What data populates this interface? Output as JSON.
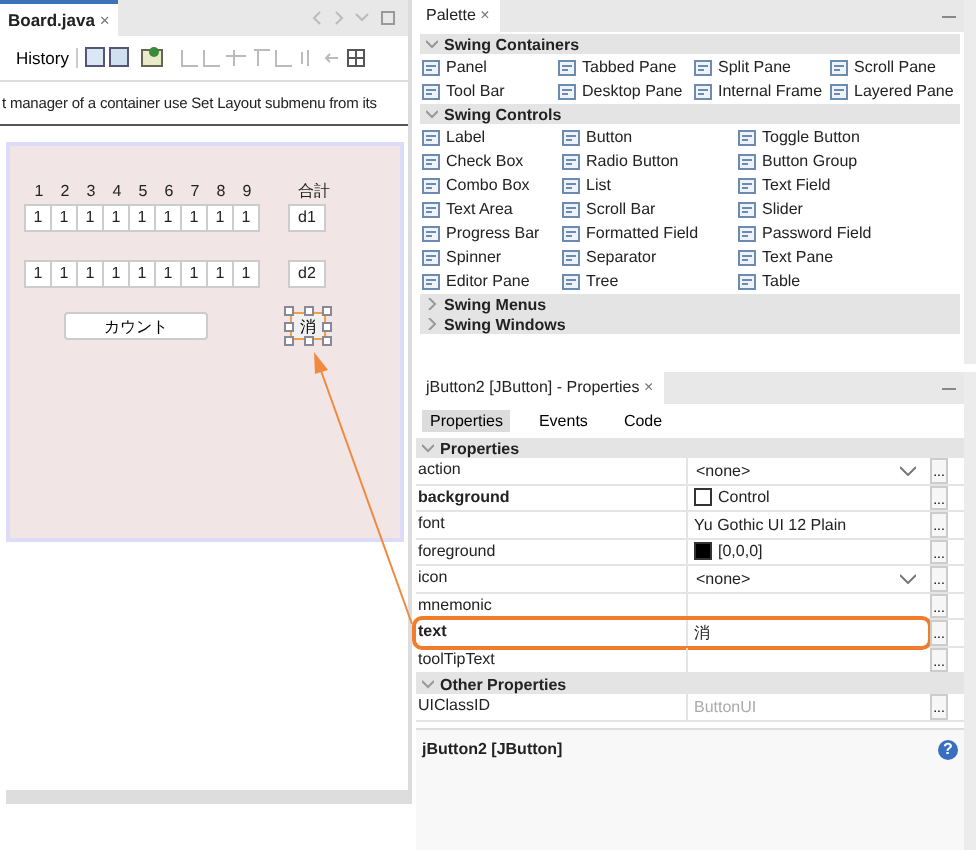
{
  "editor": {
    "tab_title": "Board.java",
    "close": "×",
    "toolbar_label": "History",
    "info_text": "t manager of a container use Set Layout submenu from its",
    "form": {
      "header_labels": [
        "1",
        "2",
        "3",
        "4",
        "5",
        "6",
        "7",
        "8",
        "9"
      ],
      "total_label": "合計",
      "rows": [
        {
          "cells": [
            "1",
            "1",
            "1",
            "1",
            "1",
            "1",
            "1",
            "1",
            "1"
          ],
          "result": "d1"
        },
        {
          "cells": [
            "1",
            "1",
            "1",
            "1",
            "1",
            "1",
            "1",
            "1",
            "1"
          ],
          "result": "d2"
        }
      ],
      "count_button": "カウント",
      "selected_button": {
        "label": "消",
        "selected": true
      }
    }
  },
  "palette": {
    "title": "Palette",
    "close": "×",
    "sections": [
      {
        "title": "Swing Containers",
        "expanded": true,
        "items": [
          {
            "label": "Panel"
          },
          {
            "label": "Tabbed Pane"
          },
          {
            "label": "Split Pane"
          },
          {
            "label": "Scroll Pane"
          },
          {
            "label": "Tool Bar"
          },
          {
            "label": "Desktop Pane"
          },
          {
            "label": "Internal Frame"
          },
          {
            "label": "Layered Pane"
          }
        ]
      },
      {
        "title": "Swing Controls",
        "expanded": true,
        "items": [
          {
            "label": "Label"
          },
          {
            "label": "Button"
          },
          {
            "label": "Toggle Button"
          },
          {
            "label": "Check Box"
          },
          {
            "label": "Radio Button"
          },
          {
            "label": "Button Group"
          },
          {
            "label": "Combo Box"
          },
          {
            "label": "List"
          },
          {
            "label": "Text Field"
          },
          {
            "label": "Text Area"
          },
          {
            "label": "Scroll Bar"
          },
          {
            "label": "Slider"
          },
          {
            "label": "Progress Bar"
          },
          {
            "label": "Formatted Field"
          },
          {
            "label": "Password Field"
          },
          {
            "label": "Spinner"
          },
          {
            "label": "Separator"
          },
          {
            "label": "Text Pane"
          },
          {
            "label": "Editor Pane"
          },
          {
            "label": "Tree"
          },
          {
            "label": "Table"
          }
        ]
      },
      {
        "title": "Swing Menus",
        "expanded": false
      },
      {
        "title": "Swing Windows",
        "expanded": false
      }
    ]
  },
  "properties": {
    "title": "jButton2 [JButton] - Properties",
    "close": "×",
    "tabs": [
      {
        "label": "Properties",
        "selected": true
      },
      {
        "label": "Events",
        "selected": false
      },
      {
        "label": "Code",
        "selected": false
      }
    ],
    "groups": [
      {
        "title": "Properties",
        "expanded": true,
        "rows": [
          {
            "name": "action",
            "bold": false,
            "kind": "dropdown",
            "value": "<none>",
            "highlighted": false
          },
          {
            "name": "background",
            "bold": true,
            "kind": "color",
            "color": "#ffffff",
            "value": "Control",
            "highlighted": false
          },
          {
            "name": "font",
            "bold": false,
            "kind": "text",
            "value": "Yu Gothic UI 12 Plain",
            "highlighted": false,
            "disabled": false
          },
          {
            "name": "foreground",
            "bold": false,
            "kind": "color",
            "color": "#000000",
            "value": "[0,0,0]",
            "highlighted": false
          },
          {
            "name": "icon",
            "bold": false,
            "kind": "dropdown",
            "value": "<none>",
            "highlighted": false
          },
          {
            "name": "mnemonic",
            "bold": false,
            "kind": "text",
            "highlighted": false
          },
          {
            "name": "text",
            "bold": true,
            "kind": "text",
            "value": "消",
            "highlighted": true,
            "disabled": false
          },
          {
            "name": "toolTipText",
            "bold": false,
            "kind": "text",
            "highlighted": false
          }
        ]
      },
      {
        "title": "Other Properties",
        "expanded": true,
        "rows": [
          {
            "name": "UIClassID",
            "bold": false,
            "kind": "text",
            "value": "ButtonUI",
            "highlighted": false,
            "disabled": true
          }
        ]
      }
    ],
    "dots": "...",
    "footer": "jButton2 [JButton]",
    "help": "?"
  }
}
